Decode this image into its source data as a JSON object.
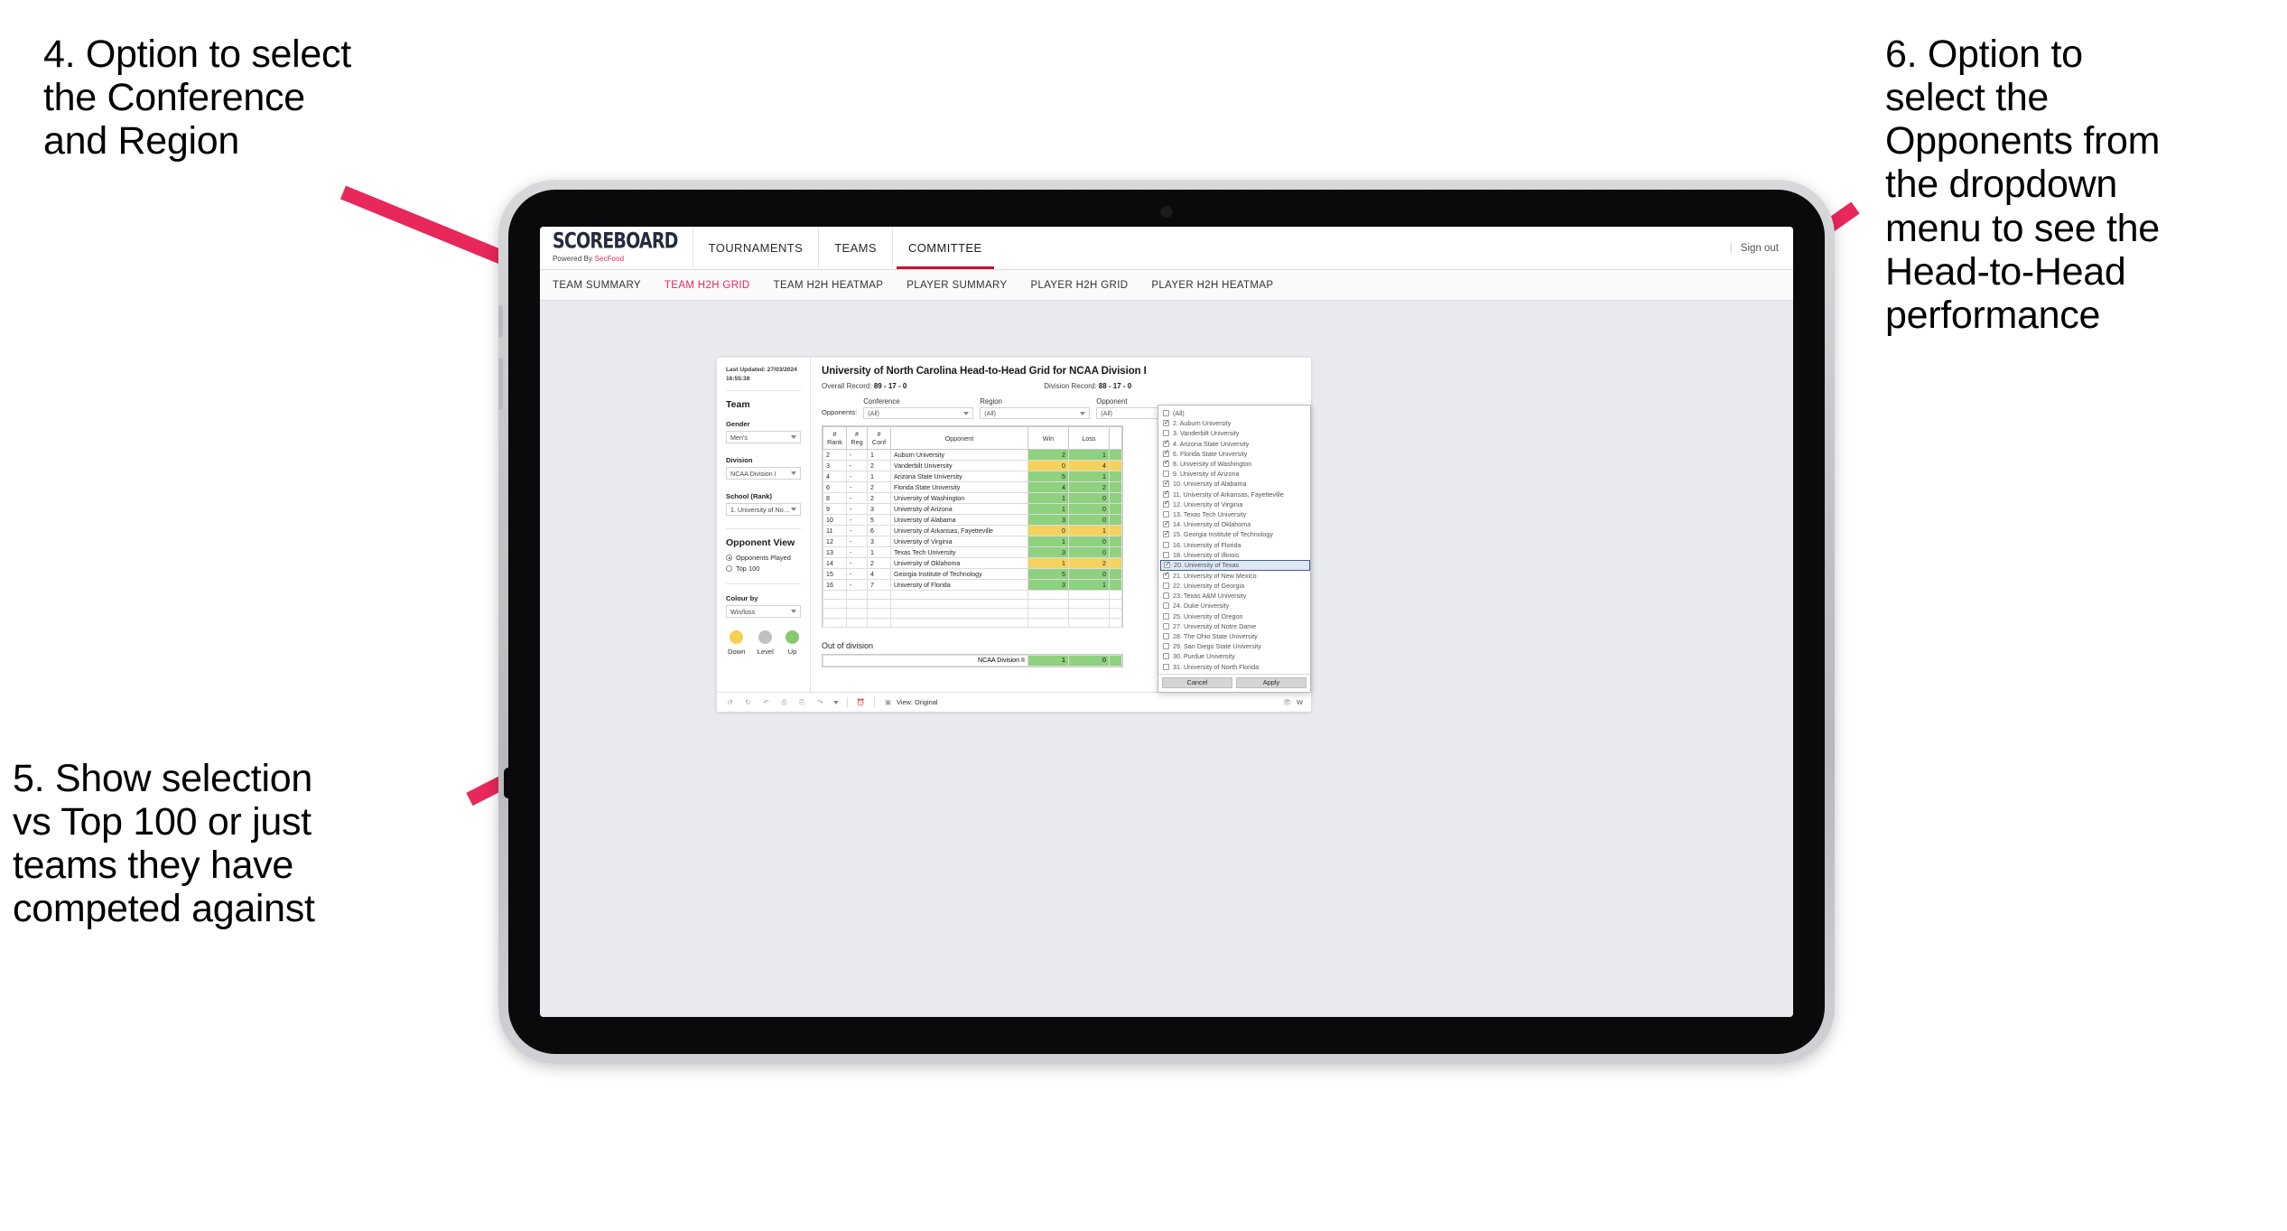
{
  "annotations": [
    {
      "id": "a4",
      "text": "4. Option to select\nthe Conference\nand Region"
    },
    {
      "id": "a5",
      "text": "5. Show selection\nvs Top 100 or just\nteams they have\ncompeted against"
    },
    {
      "id": "a6",
      "text": "6. Option to\nselect the\nOpponents from\nthe dropdown\nmenu to see the\nHead-to-Head\nperformance"
    }
  ],
  "arrow_color": "#e8275b",
  "site": {
    "brand": {
      "title": "SCOREBOARD",
      "sub_plain": "Powered By ",
      "sub_accent": "SecFood"
    },
    "topnav": [
      {
        "label": "TOURNAMENTS",
        "active": false
      },
      {
        "label": "TEAMS",
        "active": false
      },
      {
        "label": "COMMITTEE",
        "active": true
      }
    ],
    "signout": "Sign out",
    "subnav": [
      {
        "label": "TEAM SUMMARY",
        "active": false
      },
      {
        "label": "TEAM H2H GRID",
        "active": true
      },
      {
        "label": "TEAM H2H HEATMAP",
        "active": false
      },
      {
        "label": "PLAYER SUMMARY",
        "active": false
      },
      {
        "label": "PLAYER H2H GRID",
        "active": false
      },
      {
        "label": "PLAYER H2H HEATMAP",
        "active": false
      }
    ]
  },
  "rail": {
    "updated": "Last Updated: 27/03/2024\n16:55:38",
    "team_heading": "Team",
    "gender_label": "Gender",
    "gender_value": "Men's",
    "division_label": "Division",
    "division_value": "NCAA Division I",
    "school_label": "School (Rank)",
    "school_value": "1. University of Nort...",
    "opponent_view_heading": "Opponent View",
    "opponent_view_options": [
      {
        "label": "Opponents Played",
        "selected": true
      },
      {
        "label": "Top 100",
        "selected": false
      }
    ],
    "colour_by_label": "Colour by",
    "colour_by_value": "Win/loss",
    "legend": [
      {
        "caption": "Down",
        "color": "#f2d14f"
      },
      {
        "caption": "Level",
        "color": "#bfc0c2"
      },
      {
        "caption": "Up",
        "color": "#87c96e"
      }
    ]
  },
  "viz": {
    "title": "University of North Carolina Head-to-Head Grid for NCAA Division I",
    "overall_record_label": "Overall Record:",
    "overall_record_value": "89 - 17 - 0",
    "division_record_label": "Division Record:",
    "division_record_value": "88 - 17 - 0",
    "opponents_label": "Opponents:",
    "filters": [
      {
        "name": "Conference",
        "value": "(All)"
      },
      {
        "name": "Region",
        "value": "(All)"
      },
      {
        "name": "Opponent",
        "value": "(All)"
      }
    ],
    "out_of_division_label": "Out of division",
    "out_of_division_row": {
      "name": "NCAA Division II",
      "win": "1",
      "loss": "0"
    },
    "toolbar": {
      "view_label": "View: Original",
      "right_label": "W"
    }
  },
  "chart_data": {
    "type": "table",
    "title": "University of North Carolina Head-to-Head Grid for NCAA Division I",
    "columns": [
      "# Rank",
      "# Reg",
      "# Conf",
      "Opponent",
      "Win",
      "Loss"
    ],
    "rows": [
      {
        "rank": "2",
        "reg": "-",
        "conf": "1",
        "opponent": "Auburn University",
        "win": "2",
        "loss": "1",
        "state": "win"
      },
      {
        "rank": "3",
        "reg": "-",
        "conf": "2",
        "opponent": "Vanderbilt University",
        "win": "0",
        "loss": "4",
        "state": "lose"
      },
      {
        "rank": "4",
        "reg": "-",
        "conf": "1",
        "opponent": "Arizona State University",
        "win": "5",
        "loss": "1",
        "state": "win"
      },
      {
        "rank": "6",
        "reg": "-",
        "conf": "2",
        "opponent": "Florida State University",
        "win": "4",
        "loss": "2",
        "state": "win"
      },
      {
        "rank": "8",
        "reg": "-",
        "conf": "2",
        "opponent": "University of Washington",
        "win": "1",
        "loss": "0",
        "state": "win"
      },
      {
        "rank": "9",
        "reg": "-",
        "conf": "3",
        "opponent": "University of Arizona",
        "win": "1",
        "loss": "0",
        "state": "win"
      },
      {
        "rank": "10",
        "reg": "-",
        "conf": "5",
        "opponent": "University of Alabama",
        "win": "3",
        "loss": "0",
        "state": "win"
      },
      {
        "rank": "11",
        "reg": "-",
        "conf": "6",
        "opponent": "University of Arkansas, Fayetteville",
        "win": "0",
        "loss": "1",
        "state": "lose"
      },
      {
        "rank": "12",
        "reg": "-",
        "conf": "3",
        "opponent": "University of Virginia",
        "win": "1",
        "loss": "0",
        "state": "win"
      },
      {
        "rank": "13",
        "reg": "-",
        "conf": "1",
        "opponent": "Texas Tech University",
        "win": "3",
        "loss": "0",
        "state": "win"
      },
      {
        "rank": "14",
        "reg": "-",
        "conf": "2",
        "opponent": "University of Oklahoma",
        "win": "1",
        "loss": "2",
        "state": "lose"
      },
      {
        "rank": "15",
        "reg": "-",
        "conf": "4",
        "opponent": "Georgia Institute of Technology",
        "win": "5",
        "loss": "0",
        "state": "win"
      },
      {
        "rank": "16",
        "reg": "-",
        "conf": "7",
        "opponent": "University of Florida",
        "win": "3",
        "loss": "1",
        "state": "win"
      }
    ],
    "colors": {
      "win": "#8ed17f",
      "lose": "#f5d25d"
    },
    "legend": [
      "Down",
      "Level",
      "Up"
    ]
  },
  "opponent_dropdown": {
    "items": [
      {
        "label": "(All)",
        "checked": false,
        "highlighted": false
      },
      {
        "label": "2. Auburn University",
        "checked": true,
        "highlighted": false
      },
      {
        "label": "3. Vanderbilt University",
        "checked": false,
        "highlighted": false
      },
      {
        "label": "4. Arizona State University",
        "checked": true,
        "highlighted": false
      },
      {
        "label": "6. Florida State University",
        "checked": true,
        "highlighted": false
      },
      {
        "label": "8. University of Washington",
        "checked": true,
        "highlighted": false
      },
      {
        "label": "9. University of Arizona",
        "checked": false,
        "highlighted": false
      },
      {
        "label": "10. University of Alabama",
        "checked": true,
        "highlighted": false
      },
      {
        "label": "11. University of Arkansas, Fayetteville",
        "checked": true,
        "highlighted": false
      },
      {
        "label": "12. University of Virginia",
        "checked": true,
        "highlighted": false
      },
      {
        "label": "13. Texas Tech University",
        "checked": false,
        "highlighted": false
      },
      {
        "label": "14. University of Oklahoma",
        "checked": true,
        "highlighted": false
      },
      {
        "label": "15. Georgia Institute of Technology",
        "checked": true,
        "highlighted": false
      },
      {
        "label": "16. University of Florida",
        "checked": false,
        "highlighted": false
      },
      {
        "label": "18. University of Illinois",
        "checked": false,
        "highlighted": false
      },
      {
        "label": "20. University of Texas",
        "checked": true,
        "highlighted": true
      },
      {
        "label": "21. University of New Mexico",
        "checked": true,
        "highlighted": false
      },
      {
        "label": "22. University of Georgia",
        "checked": false,
        "highlighted": false
      },
      {
        "label": "23. Texas A&M University",
        "checked": false,
        "highlighted": false
      },
      {
        "label": "24. Duke University",
        "checked": false,
        "highlighted": false
      },
      {
        "label": "25. University of Oregon",
        "checked": false,
        "highlighted": false
      },
      {
        "label": "27. University of Notre Dame",
        "checked": false,
        "highlighted": false
      },
      {
        "label": "28. The Ohio State University",
        "checked": false,
        "highlighted": false
      },
      {
        "label": "29. San Diego State University",
        "checked": false,
        "highlighted": false
      },
      {
        "label": "30. Purdue University",
        "checked": false,
        "highlighted": false
      },
      {
        "label": "31. University of North Florida",
        "checked": false,
        "highlighted": false
      }
    ],
    "cancel_label": "Cancel",
    "apply_label": "Apply"
  }
}
